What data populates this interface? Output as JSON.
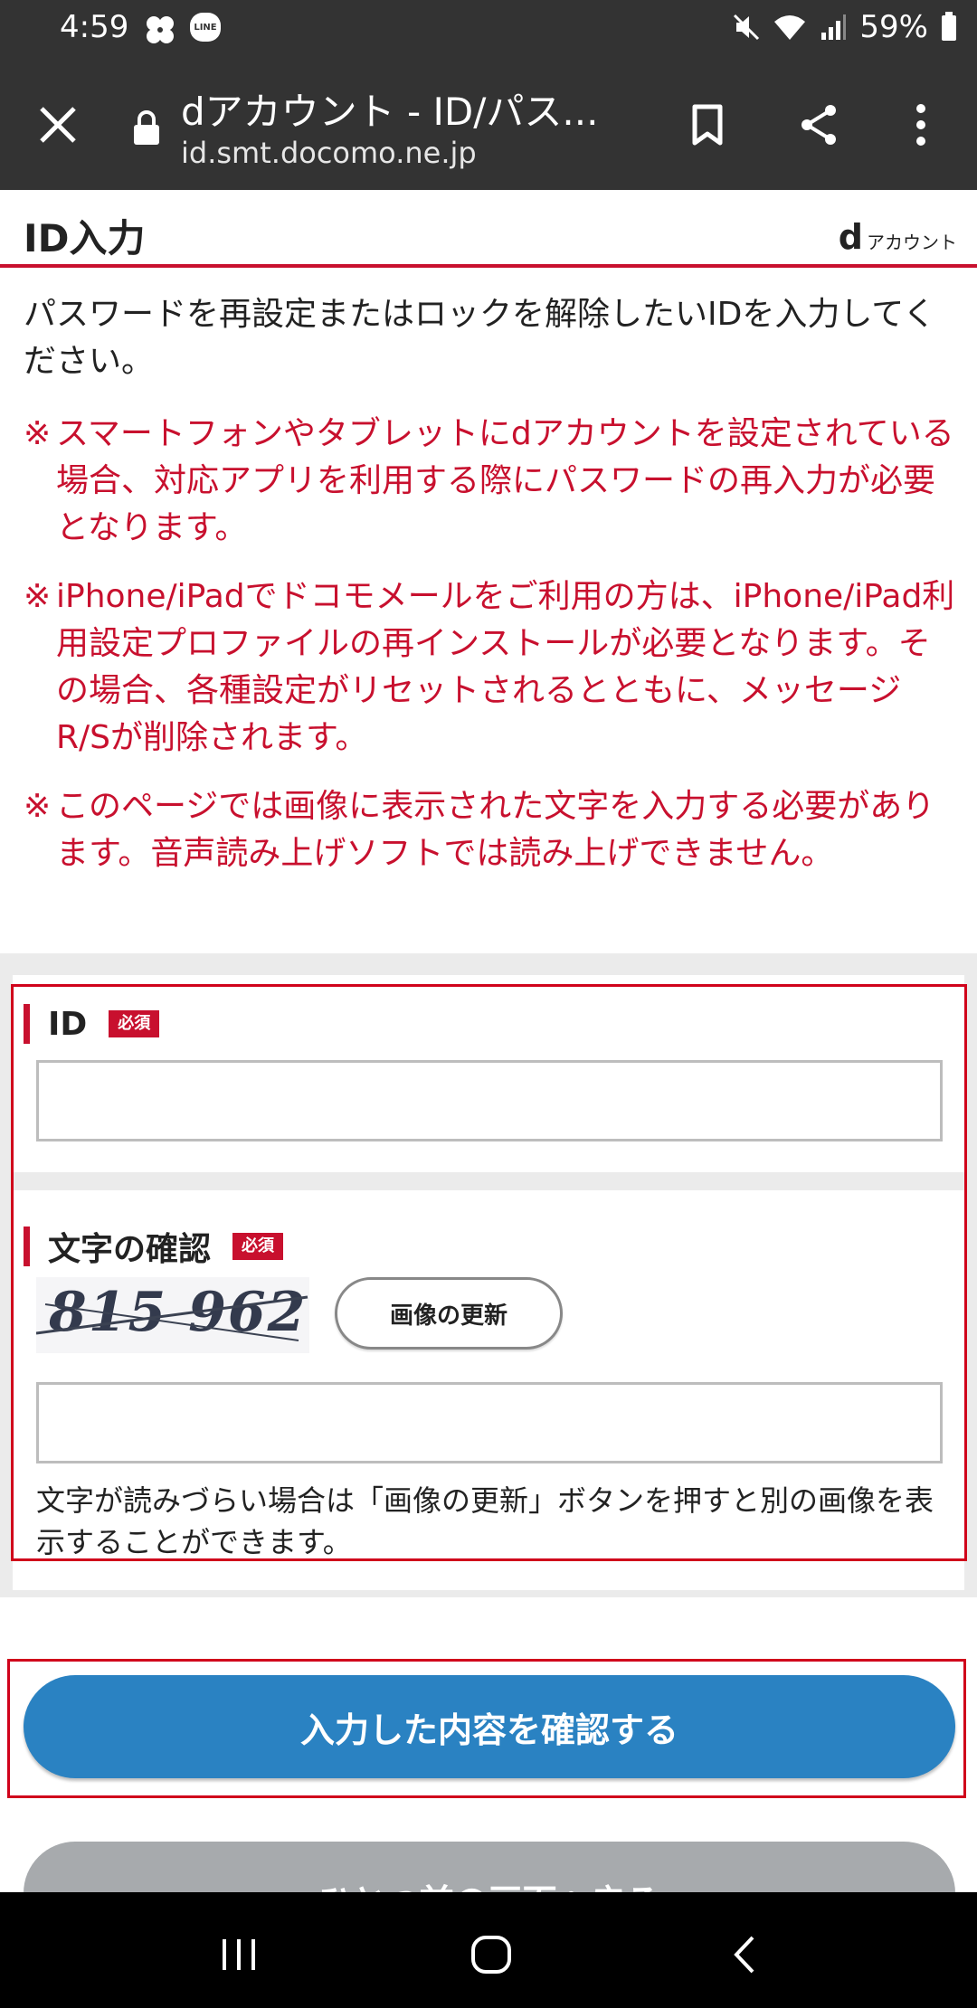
{
  "status_bar": {
    "time": "4:59",
    "line_badge": "LINE",
    "battery": "59%"
  },
  "browser": {
    "page_title": "dアカウント - ID/パス...",
    "url": "id.smt.docomo.ne.jp"
  },
  "header": {
    "title": "ID入力",
    "brand_d": "d",
    "brand_text": "アカウント"
  },
  "intro": "パスワードを再設定またはロックを解除したいIDを入力してください。",
  "notices": [
    {
      "mark": "※",
      "text": "スマートフォンやタブレットにdアカウントを設定されている場合、対応アプリを利用する際にパスワードの再入力が必要となります。"
    },
    {
      "mark": "※",
      "text": "iPhone/iPadでドコモメールをご利用の方は、iPhone/iPad利用設定プロファイルの再インストールが必要となります。その場合、各種設定がリセットされるとともに、メッセージR/Sが削除されます。"
    },
    {
      "mark": "※",
      "text": "このページでは画像に表示された文字を入力する必要があります。音声読み上げソフトでは読み上げできません。"
    }
  ],
  "form": {
    "id_label": "ID",
    "required_badge": "必須",
    "id_value": "",
    "captcha_label": "文字の確認",
    "captcha_text": "815 962",
    "refresh_button": "画像の更新",
    "captcha_value": "",
    "help_text": "文字が読みづらい場合は「画像の更新」ボタンを押すと別の画像を表示することができます。"
  },
  "buttons": {
    "confirm": "入力した内容を確認する",
    "back": "ひとつ前の画面へ戻る"
  },
  "colors": {
    "accent_red": "#c8102e",
    "primary_blue": "#2a82c2",
    "toolbar_dark": "#333333"
  }
}
